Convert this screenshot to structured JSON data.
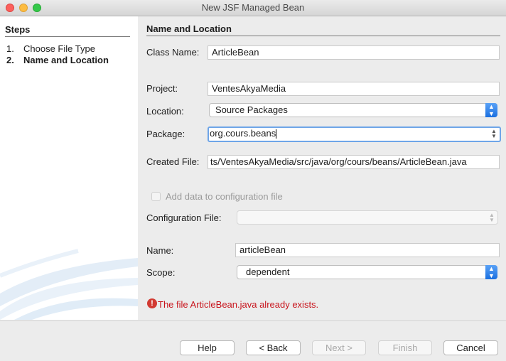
{
  "window": {
    "title": "New JSF Managed Bean"
  },
  "steps": {
    "title": "Steps",
    "items": [
      {
        "num": "1.",
        "label": "Choose File Type"
      },
      {
        "num": "2.",
        "label": "Name and Location"
      }
    ]
  },
  "panel": {
    "title": "Name and Location"
  },
  "form": {
    "class_name_label": "Class Name:",
    "class_name_value": "ArticleBean",
    "project_label": "Project:",
    "project_value": "VentesAkyaMedia",
    "location_label": "Location:",
    "location_value": "Source Packages",
    "package_label": "Package:",
    "package_value": "org.cours.beans",
    "created_file_label": "Created File:",
    "created_file_value": "ts/VentesAkyaMedia/src/java/org/cours/beans/ArticleBean.java",
    "add_config_label": "Add data to configuration file",
    "config_file_label": "Configuration File:",
    "config_file_value": "",
    "name_label": "Name:",
    "name_value": "articleBean",
    "scope_label": "Scope:",
    "scope_value": "dependent"
  },
  "error": {
    "icon": "error-icon",
    "message": "The file ArticleBean.java already exists."
  },
  "buttons": {
    "help": "Help",
    "back": "< Back",
    "next": "Next >",
    "finish": "Finish",
    "cancel": "Cancel"
  },
  "colors": {
    "error": "#c8141c",
    "accent": "#1a6fe0",
    "focus": "#6ea5e8"
  }
}
